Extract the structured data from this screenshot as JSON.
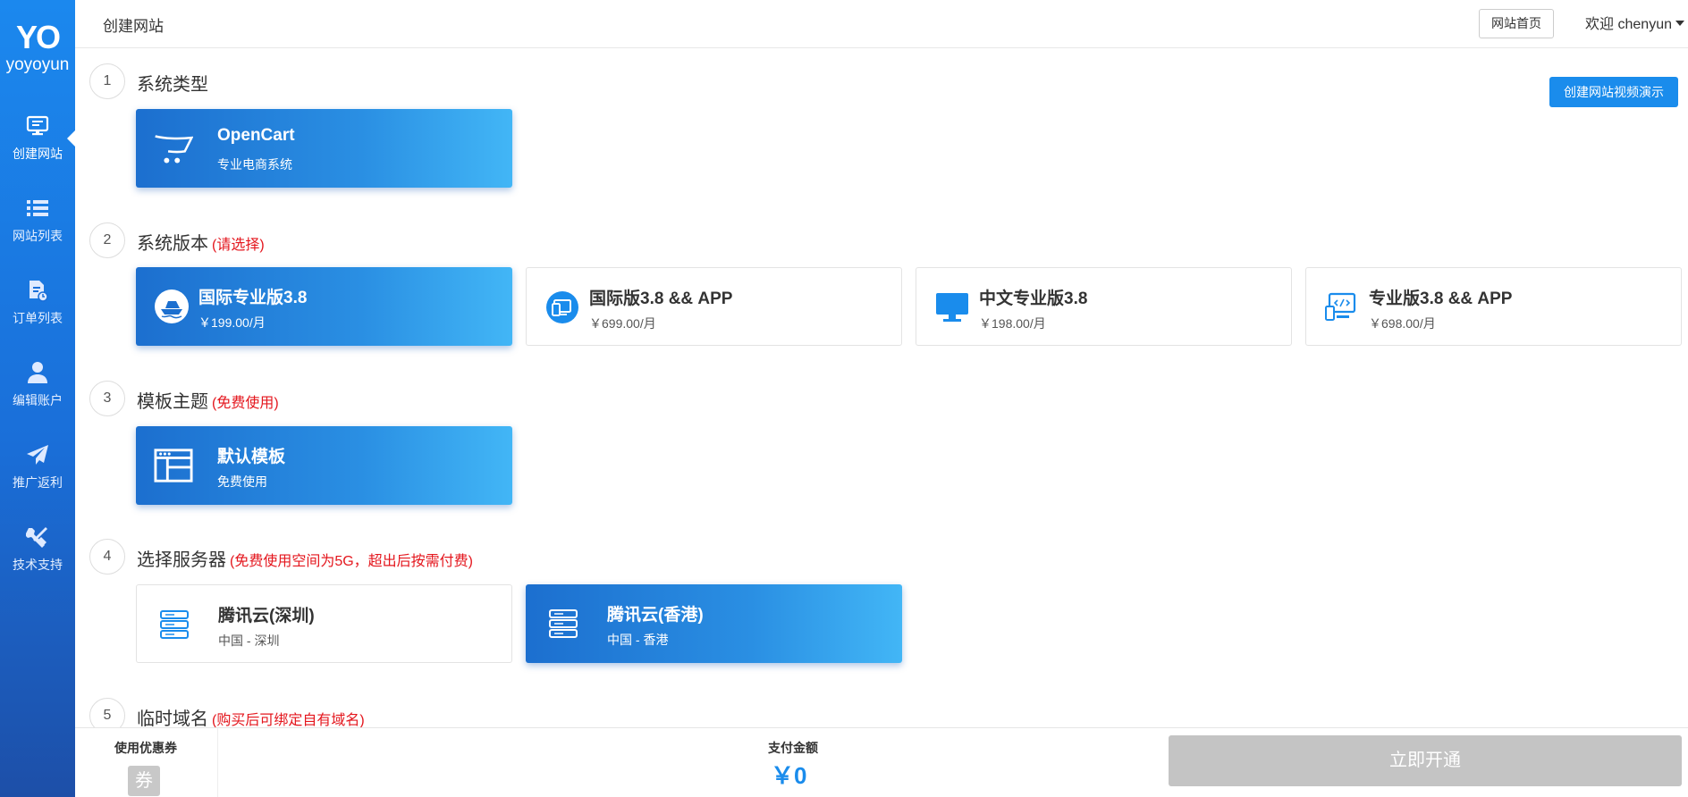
{
  "sidebar": {
    "logo_mark": "YO",
    "logo_text": "yoyoyun",
    "items": [
      {
        "label": "创建网站",
        "icon": "monitor-icon"
      },
      {
        "label": "网站列表",
        "icon": "list-icon"
      },
      {
        "label": "订单列表",
        "icon": "order-file-icon"
      },
      {
        "label": "编辑账户",
        "icon": "user-icon"
      },
      {
        "label": "推广返利",
        "icon": "paper-plane-icon"
      },
      {
        "label": "技术支持",
        "icon": "tools-icon"
      }
    ]
  },
  "header": {
    "title": "创建网站",
    "home_button": "网站首页",
    "user_greeting": "欢迎 chenyun"
  },
  "demo_button": "创建网站视频演示",
  "sections": [
    {
      "num": "1",
      "title": "系统类型",
      "note": ""
    },
    {
      "num": "2",
      "title": "系统版本",
      "note": "(请选择)"
    },
    {
      "num": "3",
      "title": "模板主题",
      "note": "(免费使用)"
    },
    {
      "num": "4",
      "title": "选择服务器",
      "note": "(免费使用空间为5G，超出后按需付费)"
    },
    {
      "num": "5",
      "title": "临时域名",
      "note": "(购买后可绑定自有域名)"
    }
  ],
  "system_types": [
    {
      "name": "OpenCart",
      "desc": "专业电商系统",
      "selected": true,
      "icon": "cart-icon"
    }
  ],
  "versions": [
    {
      "name": "国际专业版3.8",
      "price": "￥199.00/月",
      "selected": true,
      "icon": "ship-icon"
    },
    {
      "name": "国际版3.8 && APP",
      "price": "￥699.00/月",
      "selected": false,
      "icon": "devices-icon"
    },
    {
      "name": "中文专业版3.8",
      "price": "￥198.00/月",
      "selected": false,
      "icon": "desktop-icon"
    },
    {
      "name": "专业版3.8 && APP",
      "price": "￥698.00/月",
      "selected": false,
      "icon": "code-devices-icon"
    }
  ],
  "templates": [
    {
      "name": "默认模板",
      "desc": "免费使用",
      "selected": true,
      "icon": "template-icon"
    }
  ],
  "servers": [
    {
      "name": "腾讯云(深圳)",
      "region": "中国 - 深圳",
      "selected": false,
      "icon": "server-icon"
    },
    {
      "name": "腾讯云(香港)",
      "region": "中国 - 香港",
      "selected": true,
      "icon": "server-icon"
    }
  ],
  "footer": {
    "coupon_label": "使用优惠券",
    "coupon_icon_text": "券",
    "pay_label": "支付金额",
    "pay_amount": "￥0",
    "open_button": "立即开通"
  },
  "colors": {
    "accent": "#1a8cec",
    "warning": "#e4161d",
    "disabled": "#c4c4c4"
  }
}
